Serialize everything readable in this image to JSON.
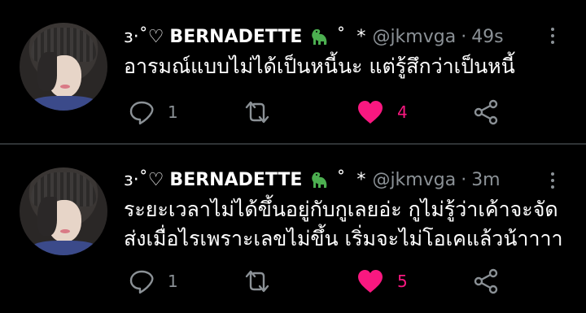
{
  "tweets": [
    {
      "name_prefix": "ɜ·˚♡ ",
      "name_main": "BERNADETTE",
      "name_suffix": " ˚ ‍ * ",
      "handle": "@jkmvga",
      "separator": "·",
      "time": "49s",
      "text_lines": [
        "อารมณ์แบบไม่ได้เป็นหนี้นะ แต่รู้สึกว่าเป็นหนี้"
      ],
      "reply_count": "1",
      "like_count": "4"
    },
    {
      "name_prefix": "ɜ·˚♡ ",
      "name_main": "BERNADETTE",
      "name_suffix": " ˚ ‍ * ",
      "handle": "@jkmvga",
      "separator": "·",
      "time": "3m",
      "text_lines": [
        "ระยะเวลาไม่ได้ขึ้นอยู่กับกูเลยอ่ะ กูไม่รู้ว่าเค้าจะจัด",
        "ส่งเมื่อไรเพราะเลขไม่ขึ้น เริ่มจะไม่โอเคแล้วน้าาาา"
      ],
      "reply_count": "1",
      "like_count": "5"
    }
  ],
  "colors": {
    "background": "#000000",
    "muted": "#8b9196",
    "like": "#f91880",
    "divider": "#2f3336",
    "dino": "#4caf50"
  },
  "icons": [
    "reply-icon",
    "retweet-icon",
    "heart-icon",
    "share-icon",
    "more-icon",
    "dinosaur-emoji"
  ]
}
